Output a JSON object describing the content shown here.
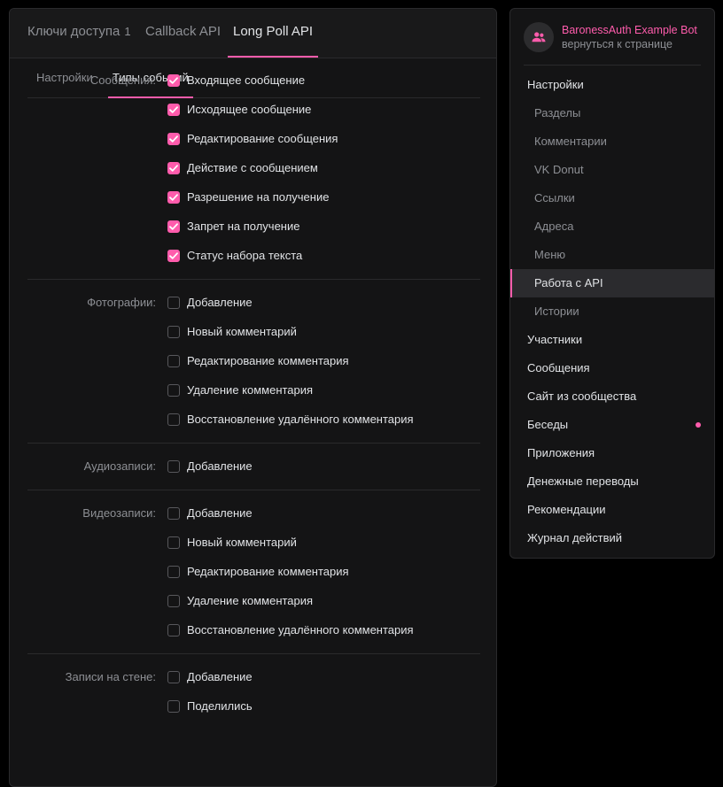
{
  "tabs_top": [
    {
      "label": "Ключи доступа",
      "count": "1"
    },
    {
      "label": "Callback API"
    },
    {
      "label": "Long Poll API"
    }
  ],
  "tabs_sub": [
    {
      "label": "Настройки"
    },
    {
      "label": "Типы событий"
    }
  ],
  "groups": [
    {
      "label": "Сообщения:",
      "items": [
        {
          "label": "Входящее сообщение",
          "checked": true
        },
        {
          "label": "Исходящее сообщение",
          "checked": true
        },
        {
          "label": "Редактирование сообщения",
          "checked": true
        },
        {
          "label": "Действие с сообщением",
          "checked": true
        },
        {
          "label": "Разрешение на получение",
          "checked": true
        },
        {
          "label": "Запрет на получение",
          "checked": true
        },
        {
          "label": "Статус набора текста",
          "checked": true
        }
      ]
    },
    {
      "label": "Фотографии:",
      "items": [
        {
          "label": "Добавление",
          "checked": false
        },
        {
          "label": "Новый комментарий",
          "checked": false
        },
        {
          "label": "Редактирование комментария",
          "checked": false
        },
        {
          "label": "Удаление комментария",
          "checked": false
        },
        {
          "label": "Восстановление удалённого комментария",
          "checked": false
        }
      ]
    },
    {
      "label": "Аудиозаписи:",
      "items": [
        {
          "label": "Добавление",
          "checked": false
        }
      ]
    },
    {
      "label": "Видеозаписи:",
      "items": [
        {
          "label": "Добавление",
          "checked": false
        },
        {
          "label": "Новый комментарий",
          "checked": false
        },
        {
          "label": "Редактирование комментария",
          "checked": false
        },
        {
          "label": "Удаление комментария",
          "checked": false
        },
        {
          "label": "Восстановление удалённого комментария",
          "checked": false
        }
      ]
    },
    {
      "label": "Записи на стене:",
      "items": [
        {
          "label": "Добавление",
          "checked": false
        },
        {
          "label": "Поделились",
          "checked": false
        }
      ]
    }
  ],
  "sidebar": {
    "title": "BaronessAuth Example Bot",
    "subtitle": "вернуться к странице",
    "avatar_icon": "community-icon",
    "items": [
      {
        "label": "Настройки",
        "sub": false
      },
      {
        "label": "Разделы",
        "sub": true
      },
      {
        "label": "Комментарии",
        "sub": true
      },
      {
        "label": "VK Donut",
        "sub": true
      },
      {
        "label": "Ссылки",
        "sub": true
      },
      {
        "label": "Адреса",
        "sub": true
      },
      {
        "label": "Меню",
        "sub": true
      },
      {
        "label": "Работа с API",
        "sub": true,
        "active": true
      },
      {
        "label": "Истории",
        "sub": true
      },
      {
        "label": "Участники",
        "sub": false
      },
      {
        "label": "Сообщения",
        "sub": false
      },
      {
        "label": "Сайт из сообщества",
        "sub": false
      },
      {
        "label": "Беседы",
        "sub": false,
        "dot": true
      },
      {
        "label": "Приложения",
        "sub": false
      },
      {
        "label": "Денежные переводы",
        "sub": false
      },
      {
        "label": "Рекомендации",
        "sub": false
      },
      {
        "label": "Журнал действий",
        "sub": false
      }
    ]
  },
  "colors": {
    "accent": "#ff5cac",
    "background": "#000000",
    "panel": "#141415"
  }
}
